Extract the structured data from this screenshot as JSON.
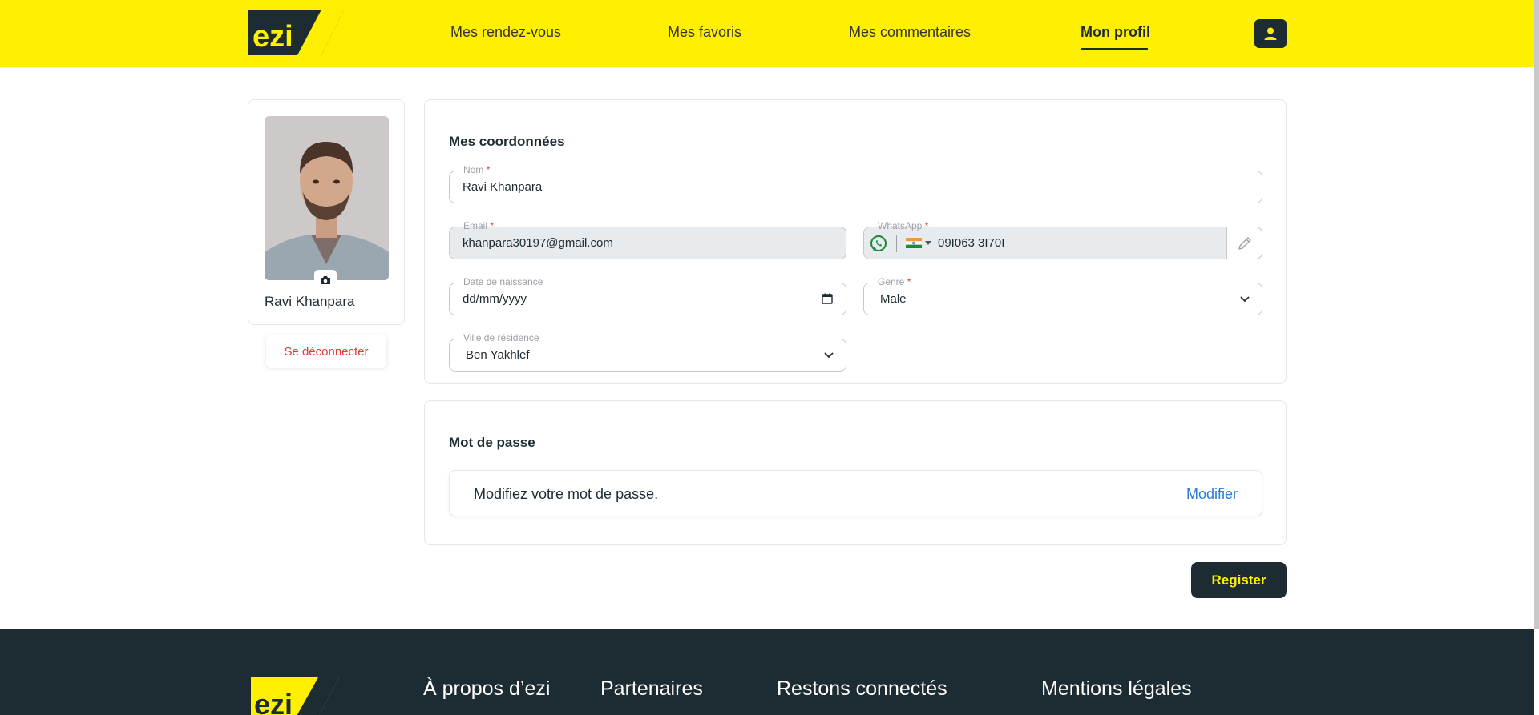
{
  "header": {
    "logo_text": "ezi",
    "nav": [
      {
        "label": "Mes rendez-vous"
      },
      {
        "label": "Mes favoris"
      },
      {
        "label": "Mes commentaires"
      },
      {
        "label": "Mon profil",
        "active": true
      }
    ],
    "user_icon": "user-icon"
  },
  "profile": {
    "name": "Ravi Khanpara",
    "camera_icon": "camera-icon",
    "logout_label": "Se déconnecter"
  },
  "coordonnees": {
    "title": "Mes coordonnées",
    "nom": {
      "label": "Nom",
      "value": "Ravi Khanpara"
    },
    "email": {
      "label": "Email",
      "value": "khanpara30197@gmail.com"
    },
    "whatsapp": {
      "label": "WhatsApp",
      "value": "09I063 3I70I",
      "country_flag": "india-flag-icon"
    },
    "naissance": {
      "label": "Date de naissance",
      "placeholder": "dd/mm/yyyy"
    },
    "genre": {
      "label": "Genre",
      "value": "Male"
    },
    "ville": {
      "label": "Ville de résidence",
      "value": "Ben Yakhlef"
    }
  },
  "password": {
    "title": "Mot de passe",
    "text": "Modifiez votre mot de passe.",
    "link": "Modifier"
  },
  "register_label": "Register",
  "footer": {
    "logo_text": "ezi",
    "headings": [
      "À propos d’ezi",
      "Partenaires",
      "Restons connectés",
      "Mentions légales"
    ]
  },
  "colors": {
    "brand_yellow": "#fff000",
    "brand_dark": "#1d2b33",
    "danger": "#e53935",
    "link": "#2b7bd6"
  }
}
